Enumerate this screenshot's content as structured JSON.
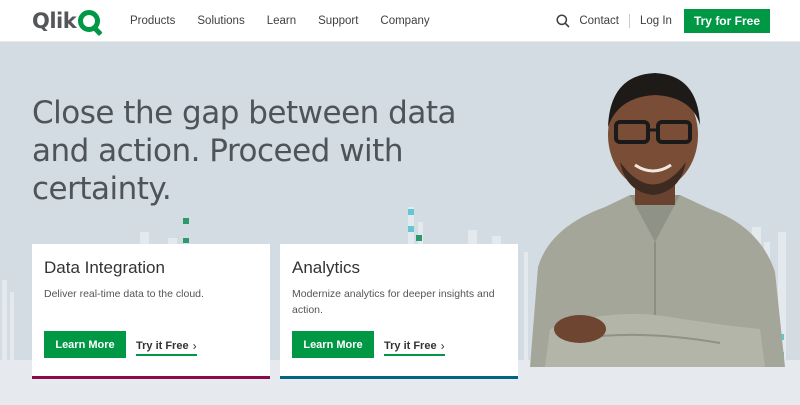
{
  "nav": {
    "logo_text": "Qlik",
    "menu": [
      "Products",
      "Solutions",
      "Learn",
      "Support",
      "Company"
    ],
    "contact": "Contact",
    "login": "Log In",
    "try_free": "Try for Free"
  },
  "hero": {
    "title": "Close the gap between data and action. Proceed with certainty."
  },
  "cards": [
    {
      "title": "Data Integration",
      "description": "Deliver real-time data to the cloud.",
      "learn_more": "Learn More",
      "try_free": "Try it Free",
      "accent": "#8a0a4b"
    },
    {
      "title": "Analytics",
      "description": "Modernize analytics for deeper insights and action.",
      "learn_more": "Learn More",
      "try_free": "Try it Free",
      "accent": "#006580"
    }
  ],
  "colors": {
    "brand_green": "#009845",
    "hero_bg": "#d3dbe3",
    "text_dark": "#4f5459"
  },
  "icons": {
    "search": "search-icon",
    "chevron": "chevron-right-icon"
  }
}
